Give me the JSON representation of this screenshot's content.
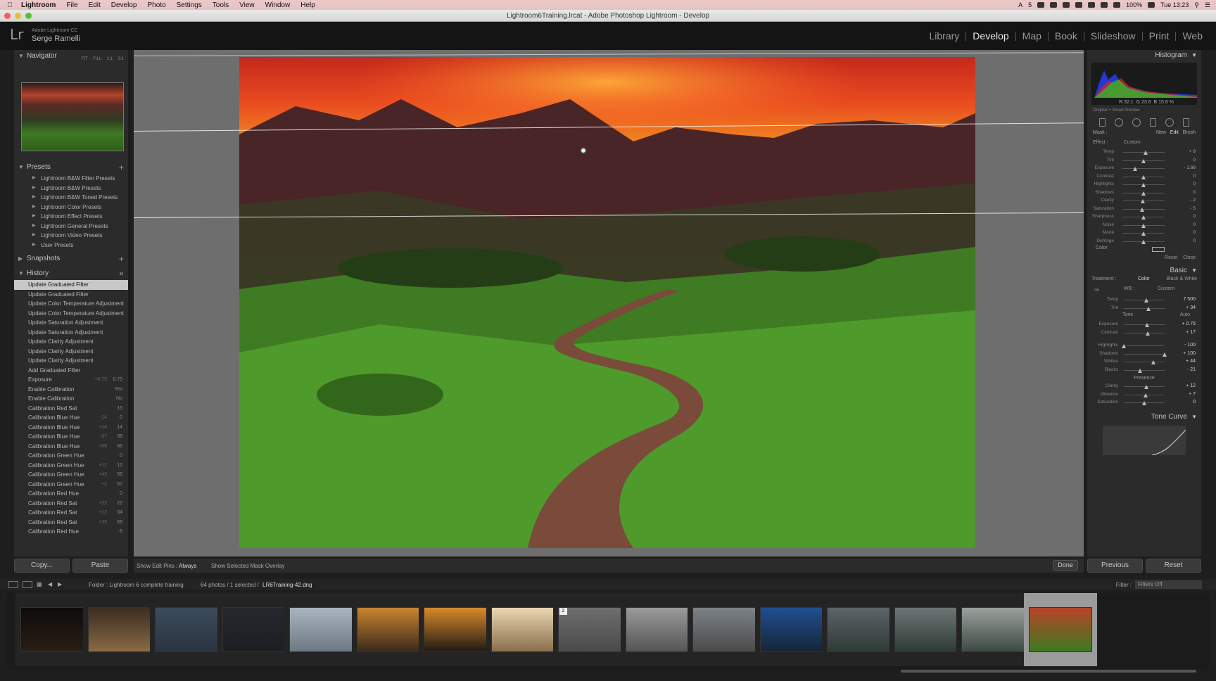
{
  "menubar": {
    "app": "Lightroom",
    "items": [
      "File",
      "Edit",
      "Develop",
      "Photo",
      "Settings",
      "Tools",
      "View",
      "Window",
      "Help"
    ],
    "battery": "100%",
    "clock": "Tue 13:23",
    "status_num": "5"
  },
  "window": {
    "title": "Lightroom6Training.lrcat - Adobe Photoshop Lightroom - Develop"
  },
  "identity": {
    "product": "Adobe Lightroom CC",
    "user": "Serge Ramelli",
    "logo": "Lr"
  },
  "modules": [
    "Library",
    "Develop",
    "Map",
    "Book",
    "Slideshow",
    "Print",
    "Web"
  ],
  "left": {
    "navigator": {
      "title": "Navigator",
      "options": [
        "FIT",
        "FILL",
        "1:1",
        "3:1"
      ]
    },
    "presets": {
      "title": "Presets",
      "items": [
        "Lightroom B&W Filter Presets",
        "Lightroom B&W Presets",
        "Lightroom B&W Toned Presets",
        "Lightroom Color Presets",
        "Lightroom Effect Presets",
        "Lightroom General Presets",
        "Lightroom Video Presets",
        "User Presets"
      ]
    },
    "snapshots": {
      "title": "Snapshots"
    },
    "history": {
      "title": "History",
      "items": [
        {
          "label": "Update Graduated Filter",
          "a": "",
          "b": ""
        },
        {
          "label": "Update Graduated Filter",
          "a": "",
          "b": ""
        },
        {
          "label": "Update Color Temperature Adjustment",
          "a": "",
          "b": ""
        },
        {
          "label": "Update Color Temperature Adjustment",
          "a": "",
          "b": ""
        },
        {
          "label": "Update Saturation Adjustment",
          "a": "",
          "b": ""
        },
        {
          "label": "Update Saturation Adjustment",
          "a": "",
          "b": ""
        },
        {
          "label": "Update Clarity Adjustment",
          "a": "",
          "b": ""
        },
        {
          "label": "Update Clarity Adjustment",
          "a": "",
          "b": ""
        },
        {
          "label": "Update Clarity Adjustment",
          "a": "",
          "b": ""
        },
        {
          "label": "Add Graduated Filter",
          "a": "",
          "b": ""
        },
        {
          "label": "Exposure",
          "a": "+0.75",
          "b": "0.75"
        },
        {
          "label": "Enable Calibration",
          "a": "",
          "b": "Yes"
        },
        {
          "label": "Enable Calibration",
          "a": "",
          "b": "No"
        },
        {
          "label": "Calibration Red Sat",
          "a": "",
          "b": "15"
        },
        {
          "label": "Calibration Blue Hue",
          "a": "-14",
          "b": "0"
        },
        {
          "label": "Calibration Blue Hue",
          "a": "+14",
          "b": "14"
        },
        {
          "label": "Calibration Blue Hue",
          "a": "-37",
          "b": "39"
        },
        {
          "label": "Calibration Blue Hue",
          "a": "+66",
          "b": "66"
        },
        {
          "label": "Calibration Green Hue",
          "a": "",
          "b": "0"
        },
        {
          "label": "Calibration Green Hue",
          "a": "+12",
          "b": "12"
        },
        {
          "label": "Calibration Green Hue",
          "a": "+43",
          "b": "55"
        },
        {
          "label": "Calibration Green Hue",
          "a": "+2",
          "b": "57"
        },
        {
          "label": "Calibration Red Hue",
          "a": "",
          "b": "0"
        },
        {
          "label": "Calibration Red Sat",
          "a": "+22",
          "b": "22"
        },
        {
          "label": "Calibration Red Sat",
          "a": "+12",
          "b": "34"
        },
        {
          "label": "Calibration Red Sat",
          "a": "+35",
          "b": "69"
        },
        {
          "label": "Calibration Red Hue",
          "a": "",
          "b": "-6"
        }
      ]
    },
    "copy_label": "Copy...",
    "paste_label": "Paste"
  },
  "center": {
    "show_pins_label": "Show Edit Pins :",
    "show_pins_value": "Always",
    "mask_overlay_label": "Show Selected Mask Overlay",
    "done_label": "Done"
  },
  "right": {
    "histogram": {
      "title": "Histogram",
      "r": "R 32.1",
      "g": "G 23.6",
      "b": "B 15.6 %",
      "preview": "Original + Smart Preview"
    },
    "mask": {
      "label": "Mask :",
      "new": "New",
      "edit": "Edit",
      "brush": "Brush"
    },
    "effect": {
      "label": "Effect :",
      "value": "Custom"
    },
    "local_sliders": [
      {
        "label": "Temp",
        "value": "+ 8",
        "pos": 0.55
      },
      {
        "label": "Tint",
        "value": "0",
        "pos": 0.5
      },
      {
        "label": "Exposure",
        "value": "- 1.66",
        "pos": 0.3
      },
      {
        "label": "Contrast",
        "value": "0",
        "pos": 0.5
      },
      {
        "label": "Highlights",
        "value": "0",
        "pos": 0.5
      },
      {
        "label": "Shadows",
        "value": "0",
        "pos": 0.5
      },
      {
        "label": "Clarity",
        "value": "- 2",
        "pos": 0.48
      },
      {
        "label": "Saturation",
        "value": "- 5",
        "pos": 0.47
      },
      {
        "label": "Sharpness",
        "value": "0",
        "pos": 0.5
      },
      {
        "label": "Noise",
        "value": "0",
        "pos": 0.5
      },
      {
        "label": "Moiré",
        "value": "0",
        "pos": 0.5
      },
      {
        "label": "Defringe",
        "value": "0",
        "pos": 0.5
      }
    ],
    "color_label": "Color",
    "reset_label": "Reset",
    "close_label": "Close",
    "basic": {
      "title": "Basic",
      "treatment_label": "Treatment :",
      "color": "Color",
      "bw": "Black & White",
      "wb_label": "WB :",
      "wb_value": "Custom",
      "tone_label": "Tone",
      "auto_label": "Auto",
      "presence_label": "Presence",
      "sliders_wb": [
        {
          "label": "Temp",
          "value": "7 500",
          "pos": 0.55
        },
        {
          "label": "Tint",
          "value": "+ 34",
          "pos": 0.6
        }
      ],
      "sliders_tone": [
        {
          "label": "Exposure",
          "value": "+ 0.75",
          "pos": 0.57
        },
        {
          "label": "Contrast",
          "value": "+ 17",
          "pos": 0.58
        }
      ],
      "sliders_tone2": [
        {
          "label": "Highlights",
          "value": "- 100",
          "pos": 0.0
        },
        {
          "label": "Shadows",
          "value": "+ 100",
          "pos": 1.0
        },
        {
          "label": "Whites",
          "value": "+ 44",
          "pos": 0.72
        },
        {
          "label": "Blacks",
          "value": "- 21",
          "pos": 0.4
        }
      ],
      "sliders_presence": [
        {
          "label": "Clarity",
          "value": "+ 12",
          "pos": 0.56
        },
        {
          "label": "Vibrance",
          "value": "+ 7",
          "pos": 0.53
        },
        {
          "label": "Saturation",
          "value": "0",
          "pos": 0.5
        }
      ]
    },
    "tone_curve": {
      "title": "Tone Curve"
    },
    "previous_label": "Previous",
    "reset2_label": "Reset"
  },
  "filmbar": {
    "folder": "Folder : Lightroom 6 complete training",
    "count": "64 photos / 1 selected /",
    "filename": "LR6Training-42.dng",
    "filter_label": "Filter :",
    "filter_value": "Filters Off"
  },
  "filmstrip": {
    "badge_number": "2",
    "thumb_colors": [
      [
        "#0d0b0a",
        "#2a1e15"
      ],
      [
        "#3a2c20",
        "#8a6a44"
      ],
      [
        "#3c4b5c",
        "#2a3440"
      ],
      [
        "#24282d",
        "#1c1f22"
      ],
      [
        "#a8b4bf",
        "#6e7882"
      ],
      [
        "#c9852f",
        "#3a2a1c"
      ],
      [
        "#d78a2a",
        "#221a14"
      ],
      [
        "#ead7b2",
        "#8a6e4c"
      ],
      [
        "#6e6e6e",
        "#4a4a4a"
      ],
      [
        "#9a9a9a",
        "#555555"
      ],
      [
        "#7d8288",
        "#4a4a4a"
      ],
      [
        "#1f4f8e",
        "#16253a"
      ],
      [
        "#5c6468",
        "#2f3a34"
      ],
      [
        "#6d7575",
        "#2e3b34"
      ],
      [
        "#9aa09d",
        "#3d4a43"
      ],
      [
        "#b84428",
        "#3c7a22"
      ]
    ]
  }
}
